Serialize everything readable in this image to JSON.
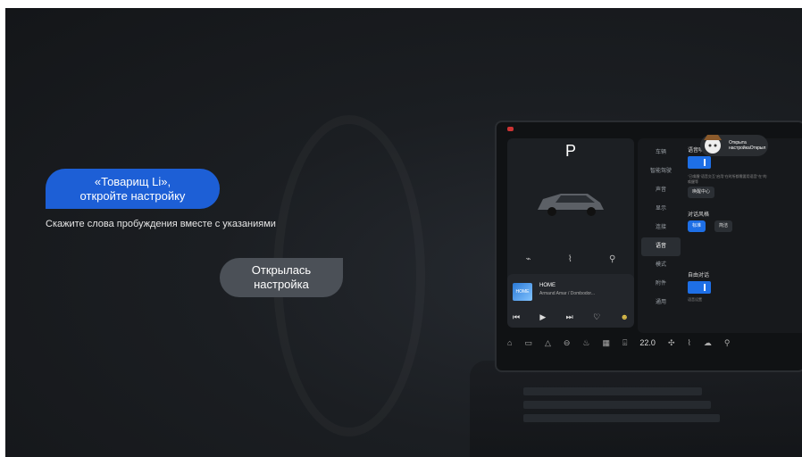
{
  "voice": {
    "user_message": "«Товарищ Li»,\nоткройте настройку",
    "hint": "Скажите слова пробуждения вместе с указаниями",
    "reply": "Открылась\nнастройка"
  },
  "car_screen": {
    "gear": "P",
    "media": {
      "cover_text": "HOME",
      "title": "HOME",
      "artist": "Armand Amar / Dombodor..."
    },
    "menu": [
      "车辆",
      "智能驾驶",
      "声音",
      "显示",
      "连接",
      "语音",
      "模式",
      "附件",
      "通用"
    ],
    "menu_selected_index": 5,
    "assistant_chip": {
      "line1": "Открыта",
      "line2": "настройкаОткрыл"
    },
    "settings": {
      "wake_label": "语音唤醒",
      "desc_small": "\"已唤醒\"语音交互\"启用\"在时所都需要用语音\"在\"的唤醒等",
      "btn_center": "唤醒中心",
      "style_label": "对话风格",
      "style_btn1": "标准",
      "style_btn2": "简洁",
      "free_label": "自由对话",
      "tone": "语音设置"
    },
    "bottom_temp": "22.0"
  }
}
